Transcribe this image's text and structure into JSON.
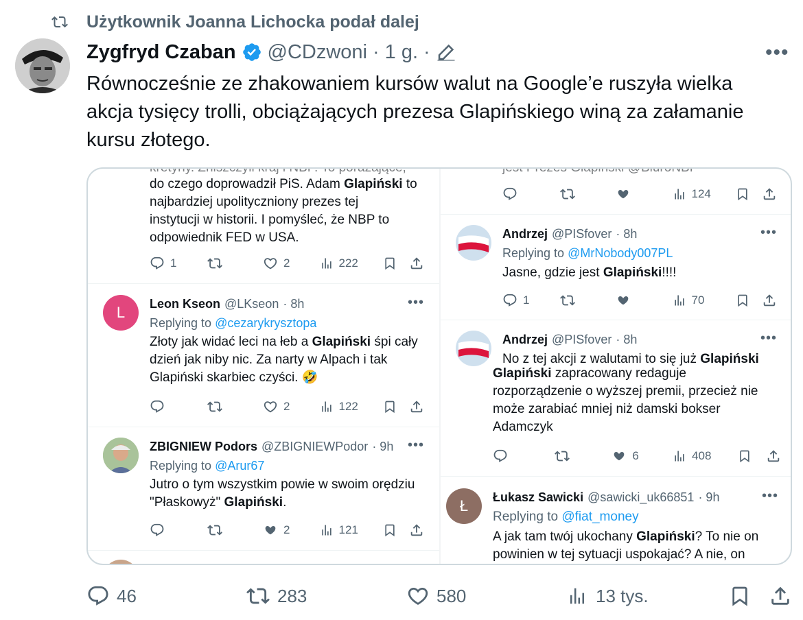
{
  "retweet": {
    "label": "Użytkownik Joanna Lichocka podał dalej"
  },
  "author": {
    "name": "Zygfryd Czaban",
    "handle": "@CDzwoni",
    "sep": "·",
    "age": "1 g.",
    "sep2": "·"
  },
  "tweet": {
    "line1": "Równocześnie ze zhakowaniem kursów walut na Google’e ruszyła wielka",
    "line2": "akcja tysięcy trolli, obciążających prezesa Glapińskiego winą za załamanie",
    "line3": "kursu złotego."
  },
  "embed": {
    "left": [
      {
        "cut_top": "kretyny. Zniszczyli kraj i NBP. To porażające,",
        "l1a": "do czego doprowadził PiS. Adam ",
        "l1b": "Glapiński",
        "l1c": " to",
        "l2": "najbardziej upolityczniony prezes tej",
        "l3": "instytucji w historii. I pomyśleć, że NBP to",
        "l4": "odpowiednik FED w USA.",
        "replies": "1",
        "reposts": "",
        "likes": "2",
        "views": "222"
      },
      {
        "name": "Leon Kseon",
        "handle": "@LKseon",
        "age": "· 8h",
        "avatar_letter": "L",
        "replying": "Replying to ",
        "to": "@cezarykrysztopa",
        "l1a": "Złoty jak widać leci na łeb a ",
        "l1b": "Glapiński",
        "l1c": " śpi cały",
        "l2": "dzień jak niby nic.  Za narty w Alpach i tak",
        "l3": "Glapiński skarbiec czyści. 🤣",
        "replies": "",
        "reposts": "",
        "likes": "2",
        "views": "122"
      },
      {
        "name": "ZBIGNIEW Podors",
        "handle": "@ZBIGNIEWPodor",
        "age": "· 9h",
        "replying": "Replying to ",
        "to": "@Arur67",
        "l1": "Jutro o tym wszystkim powie w swoim orędziu",
        "l2a": "\"Płaskowyż\" ",
        "l2b": "Glapiński",
        "l2c": ".",
        "replies": "",
        "reposts": "",
        "likes": "2",
        "views": "121"
      }
    ],
    "right": [
      {
        "cut_top": "jest Prezes Glapiński @BiuroNBP",
        "replies": "",
        "reposts": "",
        "likes": "",
        "views": "124"
      },
      {
        "name": "Andrzej",
        "handle": "@PISfover",
        "age": "· 8h",
        "replying": "Replying to ",
        "to": "@MrNobody007PL",
        "l1a": "Jasne, gdzie jest  ",
        "l1b": "Glapiński",
        "l1c": "!!!!",
        "replies": "1",
        "reposts": "",
        "likes": "",
        "views": "70"
      },
      {
        "name": "Andrzej",
        "handle": "@PISfover",
        "age": "· 8h",
        "l1a": "No z tej akcji z walutami to się już ",
        "l1b": "Glapiński",
        "l2a": "Glapiński",
        "l2b": " zapracowany redaguje",
        "l3": "rozporządzenie o wyższej premii, przecież nie",
        "l4": "może zarabiać mniej niż damski bokser",
        "l5": "Adamczyk",
        "replies": "",
        "reposts": "",
        "likes": "6",
        "views": "408"
      },
      {
        "name": "Łukasz Sawicki",
        "handle": "@sawicki_uk66851",
        "age": "· 9h",
        "avatar_letter": "Ł",
        "replying": "Replying to ",
        "to": "@fiat_money",
        "l1a": "A jak tam twój ukochany ",
        "l1b": "Glapiński",
        "l1c": "? To nie on",
        "l2": "powinien w tej sytuacji uspokajać? A nie, on"
      }
    ]
  },
  "stats": {
    "replies": "46",
    "reposts": "283",
    "likes": "580",
    "views": "13 tys."
  },
  "colors": {
    "accent": "#1d9bf0",
    "text": "#0f1419",
    "muted": "#536471",
    "border": "#cfd9de",
    "verified": "#1d9bf0"
  }
}
